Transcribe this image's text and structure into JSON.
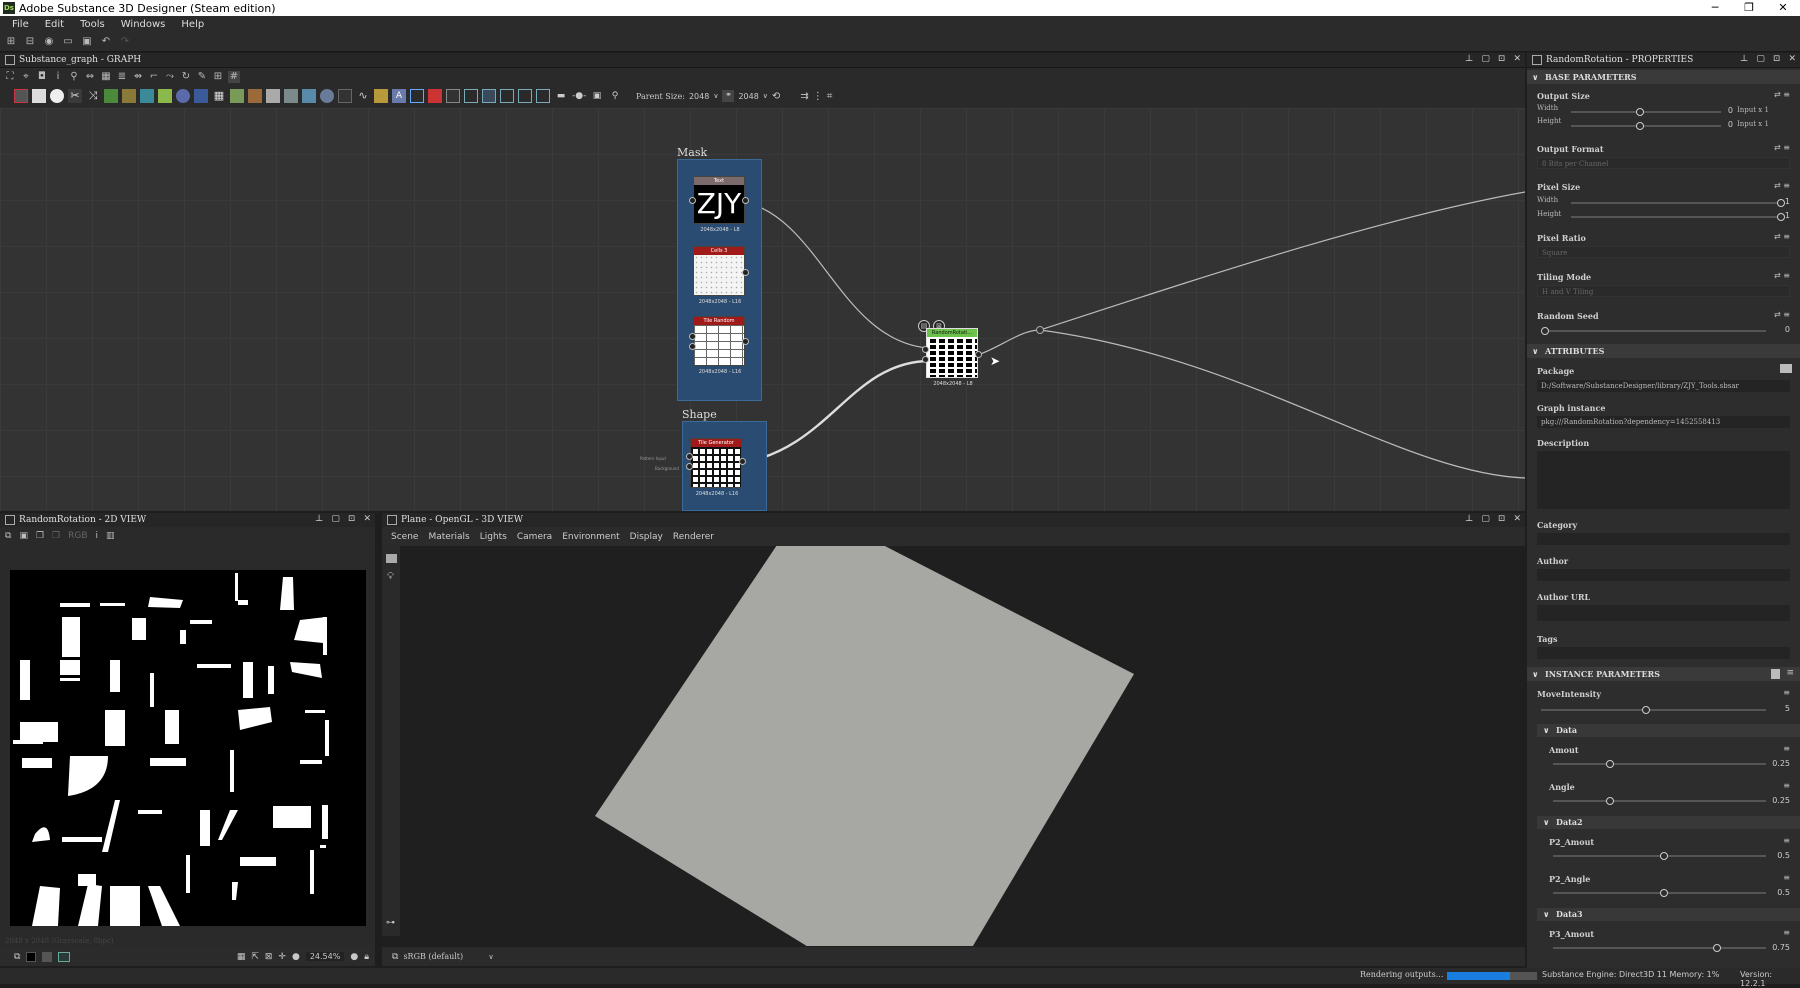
{
  "window": {
    "title": "Adobe Substance 3D Designer (Steam edition)",
    "app_icon": "Ds"
  },
  "menu": [
    "File",
    "Edit",
    "Tools",
    "Windows",
    "Help"
  ],
  "graph_panel": {
    "title": "Substance_graph - GRAPH",
    "parent_size_label": "Parent Size:",
    "parent_size_value": "2048",
    "size_value": "2048",
    "frames": [
      {
        "title": "Mask"
      },
      {
        "title": "Shape"
      }
    ],
    "nodes": [
      {
        "header": "Text",
        "content": "ZJY",
        "res": "2048x2048 - L8",
        "header_color": "#6b5a5a"
      },
      {
        "header": "Cells 3",
        "res": "2048x2048 - L16",
        "header_color": "#a11a1a"
      },
      {
        "header": "Tile Random",
        "res": "2048x2048 - L16",
        "header_color": "#a11a1a"
      },
      {
        "header": "Tile Generator",
        "res": "2048x2048 - L16",
        "header_color": "#a11a1a"
      },
      {
        "header": "RandomRotati...",
        "res": "2048x2048 - L8",
        "header_color": "#6cc24a"
      }
    ],
    "side_labels": [
      "Pattern Input",
      "Background"
    ]
  },
  "properties": {
    "title": "RandomRotation - PROPERTIES",
    "base_parameters": "BASE PARAMETERS",
    "output_size": {
      "label": "Output Size",
      "width_label": "Width",
      "height_label": "Height",
      "width_value": "0",
      "height_value": "0",
      "width_mode": "Input x 1",
      "height_mode": "Input x 1"
    },
    "output_format": {
      "label": "Output Format",
      "value": "8 Bits per Channel"
    },
    "pixel_size": {
      "label": "Pixel Size",
      "width_label": "Width",
      "height_label": "Height",
      "width_value": "1",
      "height_value": "1"
    },
    "pixel_ratio": {
      "label": "Pixel Ratio",
      "value": "Square"
    },
    "tiling_mode": {
      "label": "Tiling Mode",
      "value": "H and V Tiling"
    },
    "random_seed": {
      "label": "Random Seed",
      "value": "0"
    },
    "attributes": "ATTRIBUTES",
    "package": {
      "label": "Package",
      "value": "D:/Software/SubstanceDesigner/library/ZJY_Tools.sbsar"
    },
    "graph_instance": {
      "label": "Graph instance",
      "value": "pkg:///RandomRotation?dependency=1452558413"
    },
    "description": "Description",
    "category": "Category",
    "author": "Author",
    "author_url": "Author URL",
    "tags": "Tags",
    "instance_parameters": "INSTANCE PARAMETERS",
    "move_intensity": {
      "label": "MoveIntensity",
      "value": "5",
      "fraction": 0.45
    },
    "data": {
      "label": "Data",
      "amout_label": "Amout",
      "amout_value": "0.25",
      "angle_label": "Angle",
      "angle_value": "0.25"
    },
    "data2": {
      "label": "Data2",
      "amout_label": "P2_Amout",
      "amout_value": "0.5",
      "angle_label": "P2_Angle",
      "angle_value": "0.5"
    },
    "data3": {
      "label": "Data3",
      "amout_label": "P3_Amout",
      "amout_value": "0.75"
    }
  },
  "view2d": {
    "title": "RandomRotation - 2D VIEW",
    "info": "2048 x 2048 (Grayscale, 8bpc)",
    "zoom": "24.54%"
  },
  "view3d": {
    "title": "Plane - OpenGL - 3D VIEW",
    "tabs": [
      "Scene",
      "Materials",
      "Lights",
      "Camera",
      "Environment",
      "Display",
      "Renderer"
    ],
    "colorspace": "sRGB (default)"
  },
  "status": {
    "rendering": "Rendering outputs...",
    "engine": "Substance Engine: Direct3D 11 Memory: 1%",
    "version": "Version: 12.2.1"
  }
}
